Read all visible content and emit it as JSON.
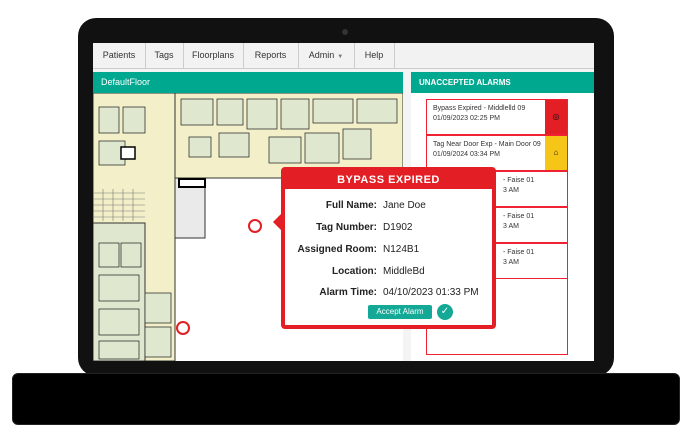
{
  "nav": {
    "items": [
      {
        "label": "Patients"
      },
      {
        "label": "Tags"
      },
      {
        "label": "Floorplans"
      },
      {
        "label": "Reports"
      },
      {
        "label": "Admin"
      },
      {
        "label": "Help"
      }
    ]
  },
  "floor": {
    "title": "DefaultFloor"
  },
  "alarms": {
    "title": "UNACCEPTED ALARMS",
    "items": [
      {
        "line1": "Bypass Expired - Middlelld 09",
        "line2": "01/09/2023 02:25 PM"
      },
      {
        "line1": "Tag Near Door Exp - Main Door 09",
        "line2": "01/09/2024 03:34 PM"
      },
      {
        "line1": "- Faise 01",
        "line2": "3 AM"
      },
      {
        "line1": "- Faise 01",
        "line2": "3 AM"
      },
      {
        "line1": "- Faise 01",
        "line2": "3 AM"
      }
    ],
    "status_colors": [
      "#e31e24",
      "#f5c518"
    ]
  },
  "popup": {
    "title": "BYPASS EXPIRED",
    "fields": [
      {
        "label": "Full Name:",
        "value": "Jane Doe"
      },
      {
        "label": "Tag Number:",
        "value": "D1902"
      },
      {
        "label": "Assigned Room:",
        "value": "N124B1"
      },
      {
        "label": "Location:",
        "value": "MiddleBd"
      },
      {
        "label": "Alarm Time:",
        "value": "04/10/2023 01:33 PM"
      }
    ],
    "accept_label": "Accept Alarm",
    "check_icon": "✓"
  },
  "colors": {
    "accent": "#00a88f",
    "alert": "#e31e24",
    "warning": "#f5c518"
  }
}
